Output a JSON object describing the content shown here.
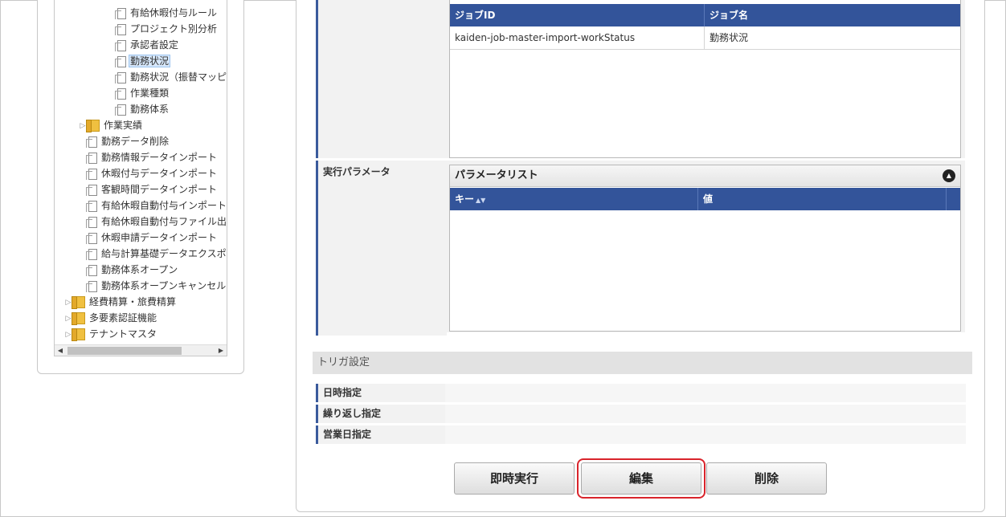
{
  "tree": {
    "items": [
      {
        "label": "有給休暇付与ルール",
        "type": "page",
        "level": 3
      },
      {
        "label": "プロジェクト別分析",
        "type": "page",
        "level": 3
      },
      {
        "label": "承認者設定",
        "type": "page",
        "level": 3
      },
      {
        "label": "勤務状況",
        "type": "page",
        "level": 3,
        "selected": true
      },
      {
        "label": "勤務状況（振替マッピ",
        "type": "page",
        "level": 3
      },
      {
        "label": "作業種類",
        "type": "page",
        "level": 3
      },
      {
        "label": "勤務体系",
        "type": "page",
        "level": 3
      },
      {
        "label": "作業実績",
        "type": "folder",
        "level": 2
      },
      {
        "label": "勤務データ削除",
        "type": "page",
        "level": 2
      },
      {
        "label": "勤務情報データインポート",
        "type": "page",
        "level": 2
      },
      {
        "label": "休暇付与データインポート",
        "type": "page",
        "level": 2
      },
      {
        "label": "客観時間データインポート",
        "type": "page",
        "level": 2
      },
      {
        "label": "有給休暇自動付与インポート",
        "type": "page",
        "level": 2
      },
      {
        "label": "有給休暇自動付与ファイル出",
        "type": "page",
        "level": 2
      },
      {
        "label": "休暇申請データインポート",
        "type": "page",
        "level": 2
      },
      {
        "label": "給与計算基礎データエクスポ",
        "type": "page",
        "level": 2
      },
      {
        "label": "勤務体系オープン",
        "type": "page",
        "level": 2
      },
      {
        "label": "勤務体系オープンキャンセル",
        "type": "page",
        "level": 2
      },
      {
        "label": "経費精算・旅費精算",
        "type": "folder",
        "level": 1
      },
      {
        "label": "多要素認証機能",
        "type": "folder",
        "level": 1
      },
      {
        "label": "テナントマスタ",
        "type": "folder",
        "level": 1
      }
    ]
  },
  "job_list": {
    "columns": [
      "ジョブID",
      "ジョブ名"
    ],
    "rows": [
      {
        "job_id": "kaiden-job-master-import-workStatus",
        "job_name": "勤務状況"
      }
    ]
  },
  "exec_params": {
    "label": "実行パラメータ",
    "grid_title": "パラメータリスト",
    "columns": [
      "キー",
      "値"
    ]
  },
  "trigger": {
    "section_title": "トリガ設定",
    "rows": [
      "日時指定",
      "繰り返し指定",
      "営業日指定"
    ]
  },
  "buttons": {
    "run_now": "即時実行",
    "edit": "編集",
    "delete": "削除"
  }
}
